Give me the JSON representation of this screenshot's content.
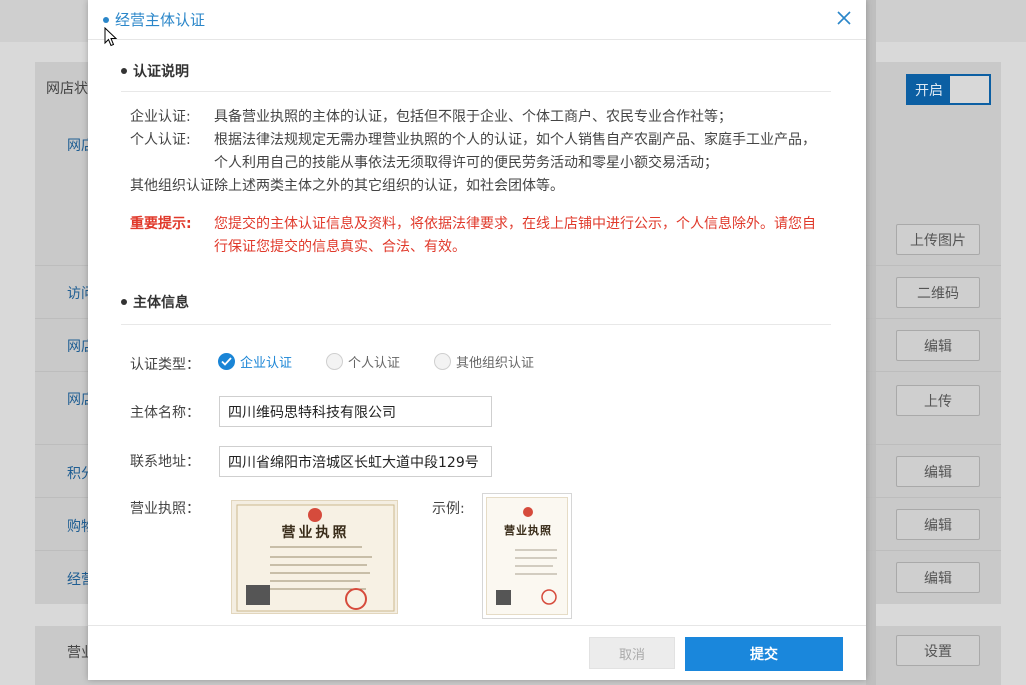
{
  "background": {
    "section_label": "网店状",
    "toggle_label": "开启",
    "left_items": [
      {
        "label": "网店",
        "kind": "link"
      },
      {
        "label": "访问",
        "kind": "link"
      },
      {
        "label": "网店",
        "kind": "link"
      },
      {
        "label": "网店",
        "kind": "link"
      },
      {
        "label": "积分",
        "kind": "link"
      },
      {
        "label": "购物",
        "kind": "link"
      },
      {
        "label": "经营",
        "kind": "link"
      },
      {
        "label": "营业",
        "kind": "plain"
      }
    ],
    "right_buttons": [
      "上传图片",
      "二维码",
      "编辑",
      "上传",
      "编辑",
      "编辑",
      "编辑",
      "设置"
    ]
  },
  "modal": {
    "title": "经营主体认证",
    "sections": {
      "intro": {
        "heading": "认证说明",
        "rows": [
          {
            "key": "企业认证:",
            "value": "具备营业执照的主体的认证，包括但不限于企业、个体工商户、农民专业合作社等；"
          },
          {
            "key": "个人认证:",
            "value": "根据法律法规规定无需办理营业执照的个人的认证，如个人销售自产农副产品、家庭手工业产品， 个人利用自己的技能从事依法无须取得许可的便民劳务活动和零星小额交易活动；"
          },
          {
            "key": "其他组织认证:",
            "value": "除上述两类主体之外的其它组织的认证，如社会团体等。"
          }
        ],
        "notice_key": "重要提示:",
        "notice_value": "您提交的主体认证信息及资料，将依据法律要求，在线上店铺中进行公示，个人信息除外。请您自行保证您提交的信息真实、合法、有效。"
      },
      "info": {
        "heading": "主体信息",
        "type_label": "认证类型：",
        "type_options": [
          "企业认证",
          "个人认证",
          "其他组织认证"
        ],
        "selected_type": "企业认证",
        "name_label": "主体名称：",
        "name_value": "四川维码思特科技有限公司",
        "address_label": "联系地址：",
        "address_value": "四川省绵阳市涪城区长虹大道中段129号",
        "license_label": "营业执照：",
        "license_title": "营业执照",
        "example_label": "示例:",
        "example_title": "营业执照"
      }
    },
    "footer": {
      "cancel_label": "取消",
      "submit_label": "提交"
    }
  },
  "colors": {
    "accent": "#1a87dc",
    "warning": "#e0392b",
    "title": "#2a86c9"
  }
}
